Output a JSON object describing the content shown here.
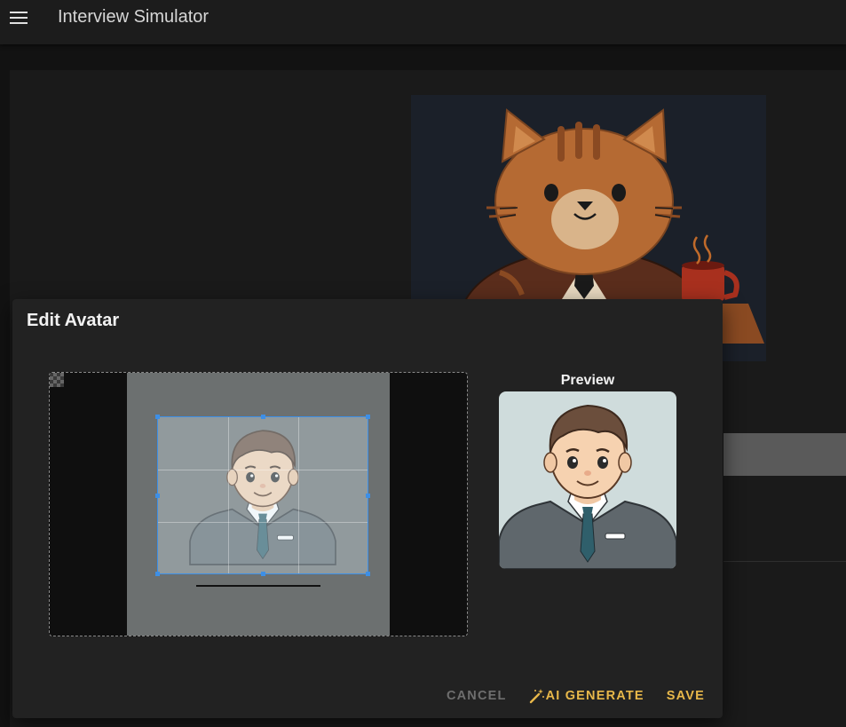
{
  "app": {
    "title": "Interview Simulator"
  },
  "dialog": {
    "title": "Edit Avatar",
    "preview_label": "Preview",
    "actions": {
      "cancel": "CANCEL",
      "ai_generate": "AI GENERATE",
      "save": "SAVE"
    }
  },
  "icons": {
    "menu": "hamburger-menu-icon",
    "wand": "magic-wand-icon"
  },
  "colors": {
    "accent": "#e8b84a",
    "crop_border": "#3d8fe6",
    "cancel": "#6e6e6e"
  }
}
